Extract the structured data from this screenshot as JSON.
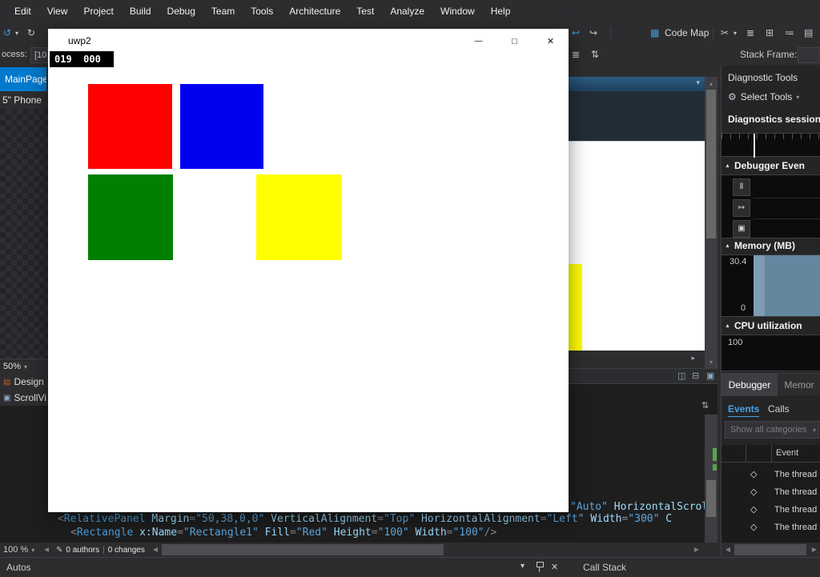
{
  "colors": {
    "accent": "#007acc",
    "red": "#ff0000",
    "blue": "#0000f0",
    "green": "#008000",
    "yellow": "#ffff00",
    "memory_fill": "#64869e",
    "memory_fill_light": "#7e9cb2"
  },
  "icons": {
    "undo": "↺",
    "redo": "↻",
    "dropdown": "▾",
    "nav_back": "↩",
    "nav_fwd": "↪",
    "code_map": "▦",
    "scissors": "✂",
    "list": "≣",
    "grid": "⊞",
    "assign": "≔",
    "panel": "▤",
    "updown": "⇅",
    "gear": "⚙",
    "section_triangle": "▲",
    "pause": "Ⅱ",
    "export": "↦",
    "snapshot": "▣",
    "diamond": "◇",
    "left_arrow": "◀",
    "right_arrow": "▶",
    "up_arrow": "▴",
    "down_arrow": "▾",
    "split_vertical": "◫",
    "split_minus": "⊟",
    "split_box": "▣",
    "grip": "⇅",
    "pen": "✎",
    "close": "✕",
    "small_right": "▸",
    "divider": "|",
    "design": "▤",
    "outline": "▣"
  },
  "menu": {
    "items": [
      "Edit",
      "View",
      "Project",
      "Build",
      "Debug",
      "Team",
      "Tools",
      "Architecture",
      "Test",
      "Analyze",
      "Window",
      "Help"
    ]
  },
  "toolbar": {
    "code_map_label": "Code Map"
  },
  "debug_bar": {
    "process_label": "ocess:",
    "process_value": "[10",
    "stack_frame_label": "Stack Frame:"
  },
  "left": {
    "doc_tab": "MainPage..",
    "device": "5\" Phone",
    "designer_zoom": "50%",
    "design_label": "Design",
    "outline_label": "ScrollVi",
    "editor_zoom": "100 %",
    "authors": "0 authors",
    "changes": "0 changes"
  },
  "app_window": {
    "title": "uwp2",
    "frame_counter": "019  000",
    "min": "—",
    "max": "□",
    "close": "✕"
  },
  "editor": {
    "lines": [
      {
        "tokens": [
          {
            "t": "\"Auto\" ",
            "c": "val"
          },
          {
            "t": "HorizontalScroll",
            "c": "attr"
          }
        ]
      },
      {
        "tokens": [
          {
            "t": "<",
            "c": "punc"
          },
          {
            "t": "RelativePanel",
            "c": "tag"
          },
          {
            "t": " ",
            "c": "punc"
          },
          {
            "t": "Margin",
            "c": "attr"
          },
          {
            "t": "=",
            "c": "punc"
          },
          {
            "t": "\"50,38,0,0\"",
            "c": "val"
          },
          {
            "t": " ",
            "c": "punc"
          },
          {
            "t": "VerticalAlignment",
            "c": "attr"
          },
          {
            "t": "=",
            "c": "punc"
          },
          {
            "t": "\"Top\"",
            "c": "val"
          },
          {
            "t": " ",
            "c": "punc"
          },
          {
            "t": "HorizontalAlignment",
            "c": "attr"
          },
          {
            "t": "=",
            "c": "punc"
          },
          {
            "t": "\"Left\"",
            "c": "val"
          },
          {
            "t": " ",
            "c": "punc"
          },
          {
            "t": "Width",
            "c": "attr"
          },
          {
            "t": "=",
            "c": "punc"
          },
          {
            "t": "\"300\"",
            "c": "val"
          },
          {
            "t": " C",
            "c": "attr"
          }
        ]
      },
      {
        "tokens": [
          {
            "t": "<",
            "c": "punc"
          },
          {
            "t": "Rectangle",
            "c": "tag"
          },
          {
            "t": " ",
            "c": "punc"
          },
          {
            "t": "x:Name",
            "c": "attr"
          },
          {
            "t": "=",
            "c": "punc"
          },
          {
            "t": "\"Rectangle1\"",
            "c": "val"
          },
          {
            "t": " ",
            "c": "punc"
          },
          {
            "t": "Fill",
            "c": "attr"
          },
          {
            "t": "=",
            "c": "punc"
          },
          {
            "t": "\"Red\"",
            "c": "val"
          },
          {
            "t": " ",
            "c": "punc"
          },
          {
            "t": "Height",
            "c": "attr"
          },
          {
            "t": "=",
            "c": "punc"
          },
          {
            "t": "\"100\"",
            "c": "val"
          },
          {
            "t": " ",
            "c": "punc"
          },
          {
            "t": "Width",
            "c": "attr"
          },
          {
            "t": "=",
            "c": "punc"
          },
          {
            "t": "\"100\"",
            "c": "val"
          },
          {
            "t": "/>",
            "c": "punc"
          }
        ]
      }
    ]
  },
  "bottom": {
    "autos_label": "Autos",
    "call_stack_label": "Call Stack"
  },
  "diagnostics": {
    "panel_title": "Diagnostic Tools",
    "select_tools": "Select Tools",
    "session_label": "Diagnostics session",
    "sections": {
      "debugger": "Debugger Even",
      "memory": "Memory (MB)",
      "cpu": "CPU utilization"
    },
    "memory_max": "30.4",
    "memory_min": "0",
    "cpu_max": "100",
    "tabs": {
      "debugger": "Debugger",
      "memory": "Memor"
    },
    "subtabs": {
      "events": "Events",
      "calls": "Calls"
    },
    "filter_placeholder": "Show all categories",
    "table_header": "Event",
    "rows": [
      "The thread",
      "The thread",
      "The thread",
      "The thread"
    ]
  }
}
